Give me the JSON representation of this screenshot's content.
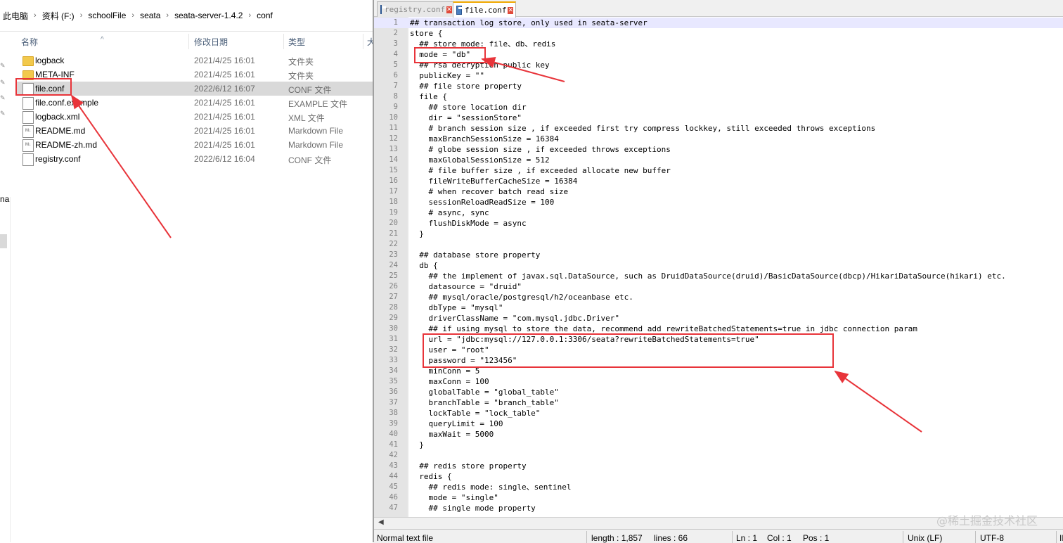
{
  "explorer": {
    "breadcrumb": [
      "此电脑",
      "资料 (F:)",
      "schoolFile",
      "seata",
      "seata-server-1.4.2",
      "conf"
    ],
    "columns": {
      "name": "名称",
      "date": "修改日期",
      "type": "类型",
      "size": "大"
    },
    "side_text": "na",
    "files": [
      {
        "name": "logback",
        "date": "2021/4/25 16:01",
        "type": "文件夹",
        "icon": "folder-icon"
      },
      {
        "name": "META-INF",
        "date": "2021/4/25 16:01",
        "type": "文件夹",
        "icon": "folder-icon"
      },
      {
        "name": "file.conf",
        "date": "2022/6/12 16:07",
        "type": "CONF 文件",
        "icon": "document-icon",
        "selected": true
      },
      {
        "name": "file.conf.example",
        "date": "2021/4/25 16:01",
        "type": "EXAMPLE 文件",
        "icon": "document-icon"
      },
      {
        "name": "logback.xml",
        "date": "2021/4/25 16:01",
        "type": "XML 文件",
        "icon": "document-icon"
      },
      {
        "name": "README.md",
        "date": "2021/4/25 16:01",
        "type": "Markdown File",
        "icon": "markdown-icon"
      },
      {
        "name": "README-zh.md",
        "date": "2021/4/25 16:01",
        "type": "Markdown File",
        "icon": "markdown-icon"
      },
      {
        "name": "registry.conf",
        "date": "2022/6/12 16:04",
        "type": "CONF 文件",
        "icon": "document-icon"
      }
    ]
  },
  "editor": {
    "tabs": [
      {
        "label": "registry.conf",
        "active": false
      },
      {
        "label": "file.conf",
        "active": true
      }
    ],
    "lines": [
      "## transaction log store, only used in seata-server",
      "store {",
      "  ## store mode: file、db、redis",
      "  mode = \"db\"",
      "  ## rsa decryption public key",
      "  publicKey = \"\"",
      "  ## file store property",
      "  file {",
      "    ## store location dir",
      "    dir = \"sessionStore\"",
      "    # branch session size , if exceeded first try compress lockkey, still exceeded throws exceptions",
      "    maxBranchSessionSize = 16384",
      "    # globe session size , if exceeded throws exceptions",
      "    maxGlobalSessionSize = 512",
      "    # file buffer size , if exceeded allocate new buffer",
      "    fileWriteBufferCacheSize = 16384",
      "    # when recover batch read size",
      "    sessionReloadReadSize = 100",
      "    # async, sync",
      "    flushDiskMode = async",
      "  }",
      "",
      "  ## database store property",
      "  db {",
      "    ## the implement of javax.sql.DataSource, such as DruidDataSource(druid)/BasicDataSource(dbcp)/HikariDataSource(hikari) etc.",
      "    datasource = \"druid\"",
      "    ## mysql/oracle/postgresql/h2/oceanbase etc.",
      "    dbType = \"mysql\"",
      "    driverClassName = \"com.mysql.jdbc.Driver\"",
      "    ## if using mysql to store the data, recommend add rewriteBatchedStatements=true in jdbc connection param",
      "    url = \"jdbc:mysql://127.0.0.1:3306/seata?rewriteBatchedStatements=true\"",
      "    user = \"root\"",
      "    password = \"123456\"",
      "    minConn = 5",
      "    maxConn = 100",
      "    globalTable = \"global_table\"",
      "    branchTable = \"branch_table\"",
      "    lockTable = \"lock_table\"",
      "    queryLimit = 100",
      "    maxWait = 5000",
      "  }",
      "",
      "  ## redis store property",
      "  redis {",
      "    ## redis mode: single、sentinel",
      "    mode = \"single\"",
      "    ## single mode property"
    ],
    "current_line": 1,
    "status": {
      "file_type": "Normal text file",
      "length": "length : 1,857",
      "lines": "lines : 66",
      "ln": "Ln : 1",
      "col": "Col : 1",
      "pos": "Pos : 1",
      "eol": "Unix (LF)",
      "encoding": "UTF-8",
      "ins": "IN"
    },
    "watermark": "@稀土掘金技术社区"
  },
  "colors": {
    "annotation": "#e8343a",
    "folder": "#f2c94c",
    "selection": "#d9d9d9",
    "current_line": "#e8e8ff"
  }
}
